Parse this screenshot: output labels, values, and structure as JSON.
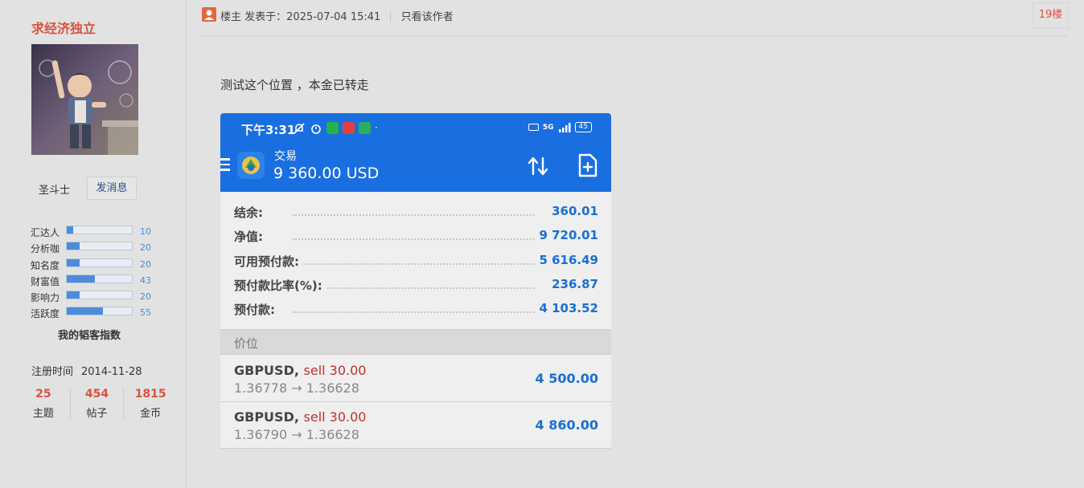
{
  "user": {
    "name": "求经济独立",
    "rank": "圣斗士",
    "message_button": "发消息",
    "stats": [
      {
        "label": "汇达人",
        "value": 10
      },
      {
        "label": "分析咖",
        "value": 20
      },
      {
        "label": "知名度",
        "value": 20
      },
      {
        "label": "财富值",
        "value": 43
      },
      {
        "label": "影响力",
        "value": 20
      },
      {
        "label": "活跃度",
        "value": 55
      }
    ],
    "stats_title": "我的韬客指数",
    "reg_label": "注册时间",
    "reg_date": "2014-11-28",
    "counts": [
      {
        "num": "25",
        "label": "主题"
      },
      {
        "num": "454",
        "label": "帖子"
      },
      {
        "num": "1815",
        "label": "金币"
      }
    ]
  },
  "post": {
    "author_label": "楼主",
    "posted_at": "发表于：2025-07-04 15:41",
    "only_author": "只看该作者",
    "floor": "19楼",
    "text": "测试这个位置 ，本金已转走"
  },
  "screenshot": {
    "status_time": "下午3:31",
    "battery": "45",
    "network": "5G",
    "account_title": "交易",
    "account_balance": "9 360.00 USD",
    "rows": [
      {
        "key": "结余:",
        "value": "360.01"
      },
      {
        "key": "净值:",
        "value": "9 720.01"
      },
      {
        "key": "可用预付款:",
        "value": "5 616.49"
      },
      {
        "key": "预付款比率(%):",
        "value": "236.87"
      },
      {
        "key": "预付款:",
        "value": "4 103.52"
      }
    ],
    "price_header": "价位",
    "positions": [
      {
        "symbol": "GBPUSD,",
        "side": "sell 30.00",
        "prices": "1.36778 → 1.36628",
        "profit": "4 500.00"
      },
      {
        "symbol": "GBPUSD,",
        "side": "sell 30.00",
        "prices": "1.36790 → 1.36628",
        "profit": "4 860.00"
      }
    ]
  },
  "colors": {
    "accent_red": "#d9533f",
    "link_blue": "#2a4e8a",
    "bar_blue": "#4d8dd8",
    "app_blue": "#1a6fe0"
  }
}
